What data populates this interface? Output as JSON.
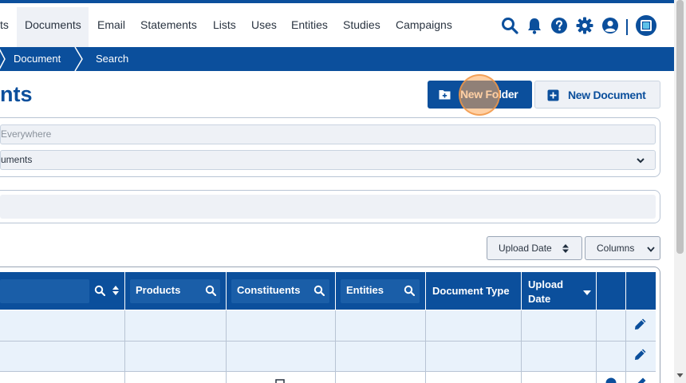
{
  "colors": {
    "brand": "#0b4f9c",
    "brand_light": "#1a5ea8",
    "panel_bg": "#eef1f6",
    "row_bg": "#e9f2fb",
    "accent_logo": "#5ec2e8",
    "click_highlight": "#f39a4a"
  },
  "topnav": {
    "items": [
      {
        "label": "ts",
        "active": false
      },
      {
        "label": "Documents",
        "active": true
      },
      {
        "label": "Email",
        "active": false
      },
      {
        "label": "Statements",
        "active": false
      },
      {
        "label": "Lists",
        "active": false
      },
      {
        "label": "Uses",
        "active": false
      },
      {
        "label": "Entities",
        "active": false
      },
      {
        "label": "Studies",
        "active": false
      },
      {
        "label": "Campaigns",
        "active": false
      }
    ],
    "icons": [
      "search-icon",
      "bell-icon",
      "help-icon",
      "gear-icon",
      "user-icon",
      "logo-icon"
    ]
  },
  "breadcrumb": {
    "items": [
      "Document",
      "Search"
    ]
  },
  "page": {
    "title": "nts"
  },
  "actions": {
    "new_folder": "New Folder",
    "new_document": "New Document"
  },
  "search": {
    "placeholder": "Everywhere",
    "scope_value": "uments"
  },
  "controls": {
    "sort_label": "Upload Date",
    "columns_label": "Columns"
  },
  "table": {
    "headers": {
      "products": "Products",
      "constituents": "Constituents",
      "entities": "Entities",
      "document_type": "Document Type",
      "upload_date_line1": "Upload",
      "upload_date_line2": "Date"
    }
  }
}
